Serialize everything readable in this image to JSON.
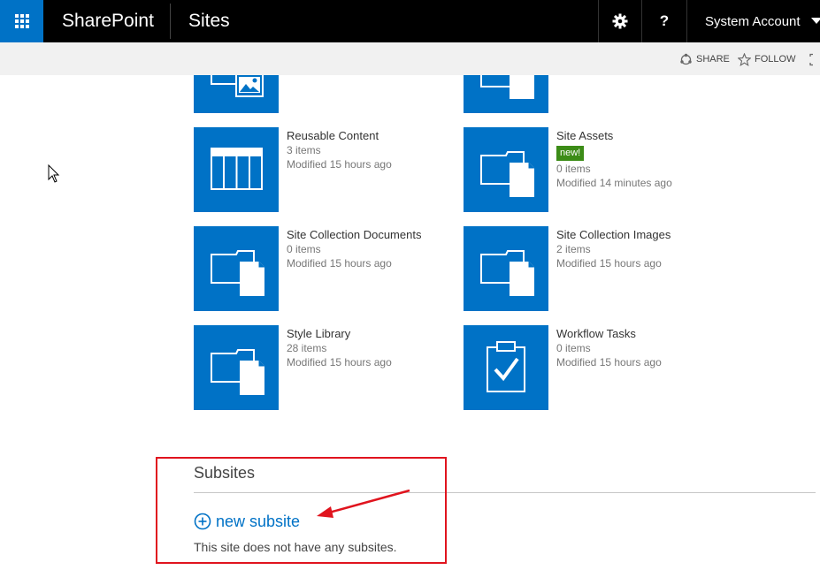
{
  "suitebar": {
    "brand": "SharePoint",
    "section": "Sites",
    "help_label": "?",
    "account_name": "System Account",
    "accent_color": "#0072c6"
  },
  "ribbon": {
    "share_label": "SHARE",
    "follow_label": "FOLLOW"
  },
  "tiles": [
    {
      "title": "Reusable Content",
      "count": "3 items",
      "modified": "Modified 15 hours ago",
      "icon": "list-icon"
    },
    {
      "title": "Site Assets",
      "badge": "new!",
      "count": "0 items",
      "modified": "Modified 14 minutes ago",
      "icon": "folder-document-icon"
    },
    {
      "title": "Site Collection Documents",
      "count": "0 items",
      "modified": "Modified 15 hours ago",
      "icon": "folder-document-icon"
    },
    {
      "title": "Site Collection Images",
      "count": "2 items",
      "modified": "Modified 15 hours ago",
      "icon": "folder-document-icon"
    },
    {
      "title": "Style Library",
      "count": "28 items",
      "modified": "Modified 15 hours ago",
      "icon": "folder-document-icon"
    },
    {
      "title": "Workflow Tasks",
      "count": "0 items",
      "modified": "Modified 15 hours ago",
      "icon": "task-clipboard-icon"
    }
  ],
  "subsites": {
    "title": "Subsites",
    "new_label": "new subsite",
    "empty_message": "This site does not have any subsites."
  },
  "colors": {
    "badge": "#3c8c17",
    "annotation": "#e0141e"
  }
}
